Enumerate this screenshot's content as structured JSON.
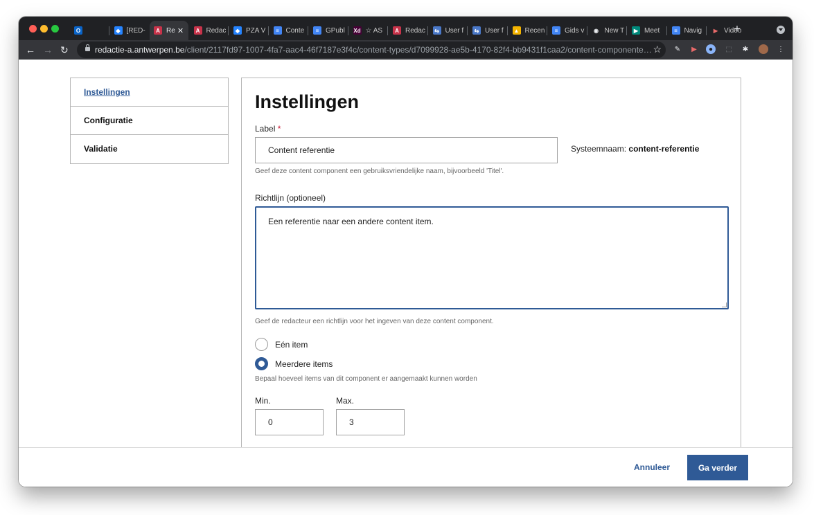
{
  "browser": {
    "tabs": [
      {
        "label": "",
        "icon": "outlook-icon",
        "color": "#0a64c8",
        "glyph": "O"
      },
      {
        "label": "[RED-",
        "icon": "jira-icon",
        "color": "#2684ff",
        "glyph": "◆"
      },
      {
        "label": "Re",
        "icon": "redactie-icon",
        "color": "#c8334a",
        "glyph": "A"
      },
      {
        "label": "Redac",
        "icon": "redactie-icon",
        "color": "#c8334a",
        "glyph": "A"
      },
      {
        "label": "PZA V",
        "icon": "jira-icon",
        "color": "#2684ff",
        "glyph": "◆"
      },
      {
        "label": "Conte",
        "icon": "docs-icon",
        "color": "#4285f4",
        "glyph": "≡"
      },
      {
        "label": "GPubl",
        "icon": "docs-icon",
        "color": "#4285f4",
        "glyph": "≡"
      },
      {
        "label": "☆ AS",
        "icon": "xd-icon",
        "color": "#470137",
        "glyph": "Xd"
      },
      {
        "label": "Redac",
        "icon": "redactie-icon",
        "color": "#c8334a",
        "glyph": "A"
      },
      {
        "label": "User f",
        "icon": "flow-icon",
        "color": "#4a78c8",
        "glyph": "⇆"
      },
      {
        "label": "User f",
        "icon": "flow-icon",
        "color": "#4a78c8",
        "glyph": "⇆"
      },
      {
        "label": "Recen",
        "icon": "drive-icon",
        "color": "#f4b400",
        "glyph": "▲"
      },
      {
        "label": "Gids v",
        "icon": "docs-icon",
        "color": "#4285f4",
        "glyph": "≡"
      },
      {
        "label": "New T",
        "icon": "chrome-icon",
        "color": "#9aa0a6",
        "glyph": "◉"
      },
      {
        "label": "Meet",
        "icon": "meet-icon",
        "color": "#00897b",
        "glyph": "▶"
      },
      {
        "label": "Navig",
        "icon": "docs-icon",
        "color": "#4285f4",
        "glyph": "≡"
      },
      {
        "label": "Video",
        "icon": "video-icon",
        "color": "#e8eaed",
        "glyph": "▶"
      }
    ],
    "active_close": "✕",
    "new_tab": "+",
    "url_host": "redactie-a.antwerpen.be",
    "url_path": "/client/2117fd97-1007-4fa7-aac4-46f7187e3f4c/content-types/d7099928-ae5b-4170-82f4-bb9431f1caa2/content-componente…"
  },
  "sidebar": {
    "items": [
      {
        "label": "Instellingen",
        "active": true
      },
      {
        "label": "Configuratie",
        "active": false
      },
      {
        "label": "Validatie",
        "active": false
      }
    ]
  },
  "form": {
    "title": "Instellingen",
    "label_field": {
      "label": "Label",
      "required_marker": "*",
      "value": "Content referentie",
      "hint": "Geef deze content component een gebruiksvriendelijke naam, bijvoorbeeld 'Titel'."
    },
    "system_name": {
      "prefix": "Systeemnaam:",
      "value": "content-referentie"
    },
    "guideline_field": {
      "label": "Richtlijn (optioneel)",
      "value": "Een referentie naar een andere content item.",
      "hint": "Geef de redacteur een richtlijn voor het ingeven van deze content component."
    },
    "multiplicity": {
      "options": [
        {
          "label": "Eén item",
          "checked": false
        },
        {
          "label": "Meerdere items",
          "checked": true
        }
      ],
      "hint": "Bepaal hoeveel items van dit component er aangemaakt kunnen worden"
    },
    "min": {
      "label": "Min.",
      "value": "0"
    },
    "max": {
      "label": "Max.",
      "value": "3"
    }
  },
  "footer": {
    "cancel_label": "Annuleer",
    "continue_label": "Ga verder"
  },
  "colors": {
    "brand_blue": "#2f5a96",
    "required_red": "#c8102e"
  }
}
